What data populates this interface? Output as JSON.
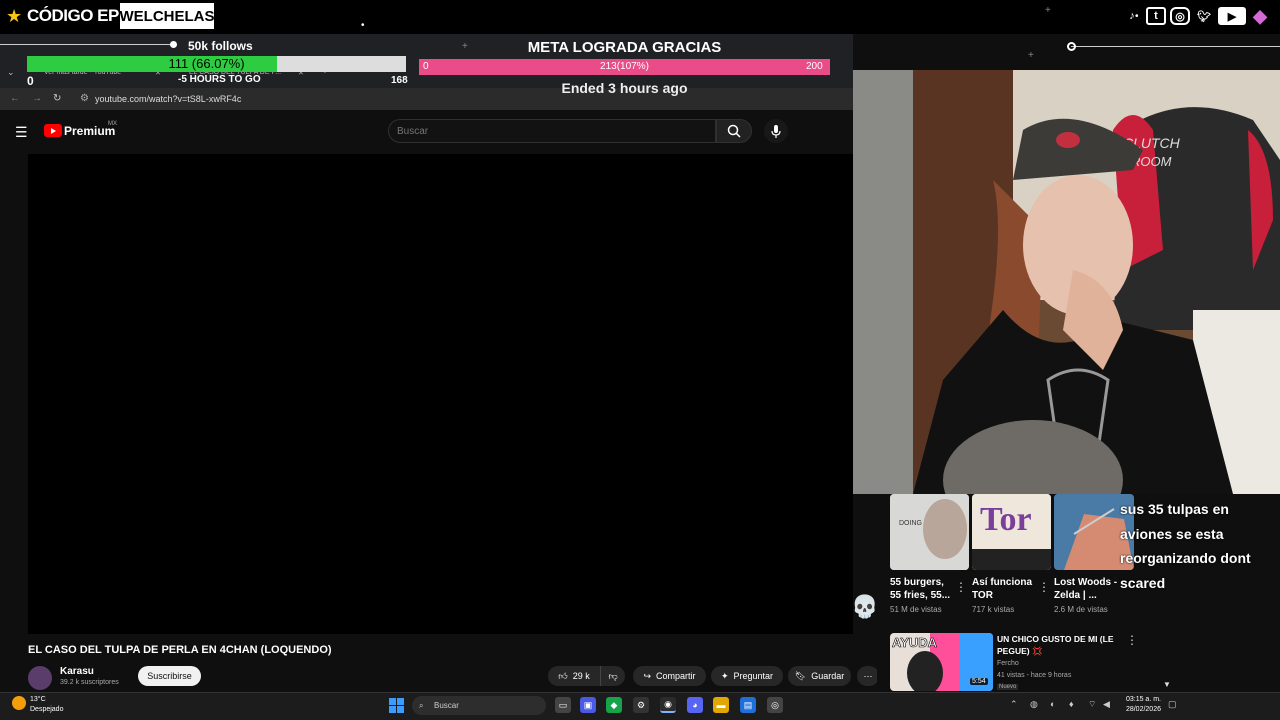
{
  "overlay": {
    "brand": "CÓDIGO EPIC",
    "channel_badge": "WELCHELAS",
    "follows": {
      "label": "50k follows",
      "progress_text": "111 (66.07%)",
      "progress_fraction": 0.6607,
      "min": "0",
      "max": "168",
      "timer": "-5 HOURS TO GO"
    },
    "meta": {
      "title": "META LOGRADA GRACIAS",
      "min": "0",
      "max": "200",
      "progress_text": "213(107%)",
      "status": "Ended 3 hours ago"
    },
    "social_icons": [
      "tiktok-icon",
      "twitch-icon",
      "instagram-icon",
      "twitter-icon",
      "youtube-icon",
      "gem-icon"
    ]
  },
  "browser": {
    "tabs": [
      {
        "label": "Ver más tarde - YouTube"
      },
      {
        "label": "EL CASO DEL TULPA DE P..."
      }
    ],
    "url": "youtube.com/watch?v=tS8L-xwRF4c"
  },
  "youtube": {
    "logo_text": "Premium",
    "region": "MX",
    "search_placeholder": "Buscar",
    "video": {
      "title": "EL CASO DEL TULPA DE PERLA EN 4CHAN (LOQUENDO)",
      "channel": "Karasu",
      "subscribers": "39.2 k suscriptores",
      "subscribe_label": "Suscribirse",
      "likes": "29 k",
      "share_label": "Compartir",
      "ask_label": "Preguntar",
      "save_label": "Guardar"
    },
    "recommendations": [
      {
        "title_line1": "55 burgers,",
        "title_line2": "55 fries, 55...",
        "views": "51 M de vistas"
      },
      {
        "title_line1": "Así funciona",
        "title_line2": "TOR",
        "views": "717 k vistas"
      },
      {
        "title_line1": "Lost Woods -",
        "title_line2": "Zelda | ...",
        "views": "2.6 M de vistas"
      }
    ],
    "rec_thumb_text": {
      "doing": "DOING",
      "tor": "Tor"
    },
    "rec2": {
      "title": "UN CHICO GUSTO DE MI (LE PEGUE) 💢",
      "channel": "Fercho",
      "meta": "41 vistas - hace 9 horas",
      "badge": "Nuevo",
      "duration": "5:54",
      "thumb_text": "AYUDA"
    }
  },
  "chat": {
    "message": "sus 35 tulpas en aviones se esta reorganizando dont scared"
  },
  "webcam": {
    "chair_text_line1": "CLUTCH",
    "chair_text_line2": "ROOM"
  },
  "taskbar": {
    "weather_temp": "13°C",
    "weather_desc": "Despejado",
    "search_label": "Buscar",
    "time": "03:15 a. m.",
    "date": "28/02/2026"
  }
}
